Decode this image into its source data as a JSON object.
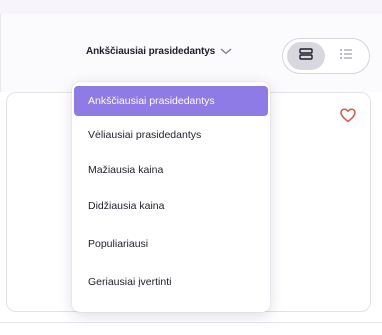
{
  "sort": {
    "current_label": "Ankščiausiai prasidedantys",
    "icon": "chevron-down-icon",
    "options": [
      {
        "label": "Ankščiausiai prasidedantys",
        "selected": true
      },
      {
        "label": "Vėliausiai prasidedantys",
        "selected": false
      },
      {
        "label": "Mažiausia kaina",
        "selected": false
      },
      {
        "label": "Didžiausia kaina",
        "selected": false
      },
      {
        "label": "Populiariausi",
        "selected": false
      },
      {
        "label": "Geriausiai įvertinti",
        "selected": false
      }
    ]
  },
  "view_toggle": {
    "active": "card-view",
    "buttons": [
      {
        "name": "card-view",
        "icon": "card-view-icon"
      },
      {
        "name": "list-view",
        "icon": "list-view-icon"
      }
    ]
  },
  "card": {
    "favorite_icon": "heart-icon"
  },
  "colors": {
    "accent": "#8f7be6",
    "heart": "#d8584c",
    "text": "#1e1e2a"
  }
}
